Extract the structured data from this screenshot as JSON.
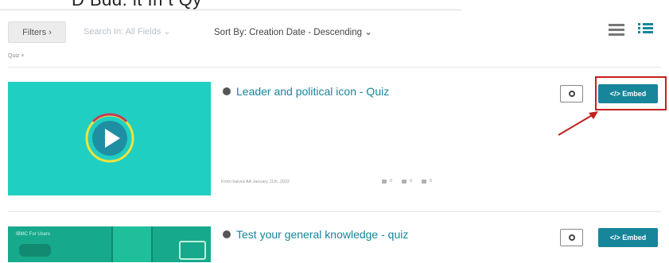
{
  "header": {
    "cut_text": "D   Bdd. lt  In   t  Qy"
  },
  "toolbar": {
    "filters_label": "Filters ›",
    "search_in_label": "Search In: All Fields ⌄",
    "sort_by_label": "Sort By:",
    "sort_by_value": "Creation Date - Descending ⌄"
  },
  "active_filter": {
    "label": "Quiz ×"
  },
  "entries": [
    {
      "title": "Leader and political icon - Quiz",
      "owner": "From katura AA January 11th, 2022",
      "likes": "0",
      "plays": "0",
      "comments": "0",
      "embed_label": "</> Embed"
    },
    {
      "title": "Test your general knowledge - quiz",
      "thumb_label": "IBMC For Users",
      "embed_label": "</> Embed"
    }
  ],
  "colors": {
    "accent": "#17859a",
    "thumb1": "#1fcfc2",
    "thumb2": "#17a98b",
    "highlight": "#c41f1f"
  }
}
